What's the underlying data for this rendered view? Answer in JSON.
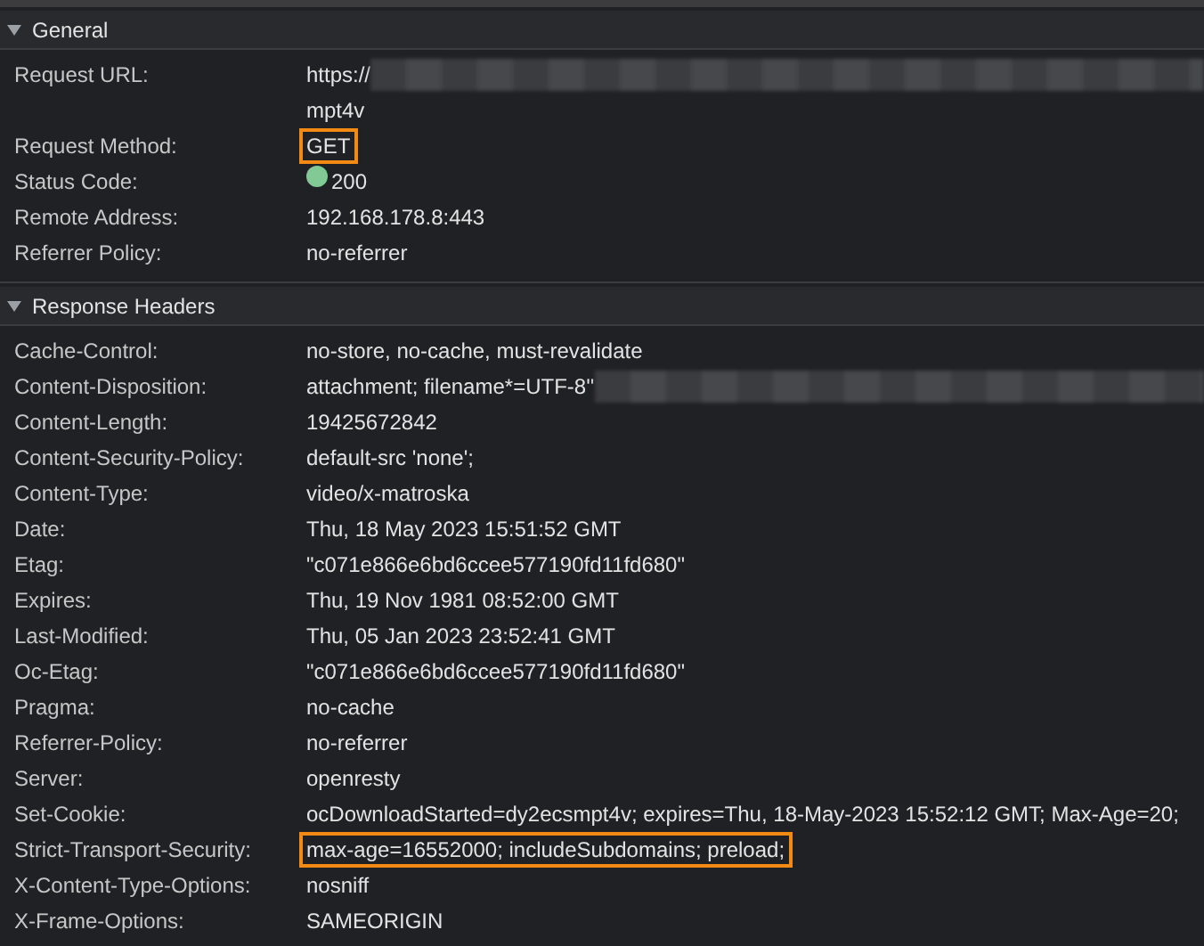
{
  "sections": [
    {
      "title": "General",
      "expanded": true,
      "rows": [
        {
          "name": "Request URL:",
          "value": "https://",
          "redacted": true,
          "continuation": "mpt4v",
          "highlighted": false
        },
        {
          "name": "Request Method:",
          "value": "GET",
          "redacted": false,
          "highlighted": true
        },
        {
          "name": "Status Code:",
          "value": "200",
          "redacted": false,
          "highlighted": false,
          "color": "#81c995"
        },
        {
          "name": "Remote Address:",
          "value": "192.168.178.8:443",
          "redacted": false,
          "highlighted": false
        },
        {
          "name": "Referrer Policy:",
          "value": "no-referrer",
          "redacted": false,
          "highlighted": false
        }
      ]
    },
    {
      "title": "Response Headers",
      "expanded": true,
      "rows": [
        {
          "name": "Cache-Control:",
          "value": "no-store, no-cache, must-revalidate",
          "redacted": false,
          "highlighted": false
        },
        {
          "name": "Content-Disposition:",
          "value": "attachment; filename*=UTF-8''",
          "redacted": true,
          "highlighted": false
        },
        {
          "name": "Content-Length:",
          "value": "19425672842",
          "redacted": false,
          "highlighted": false
        },
        {
          "name": "Content-Security-Policy:",
          "value": "default-src 'none';",
          "redacted": false,
          "highlighted": false
        },
        {
          "name": "Content-Type:",
          "value": "video/x-matroska",
          "redacted": false,
          "highlighted": false
        },
        {
          "name": "Date:",
          "value": "Thu, 18 May 2023 15:51:52 GMT",
          "redacted": false,
          "highlighted": false
        },
        {
          "name": "Etag:",
          "value": "\"c071e866e6bd6ccee577190fd11fd680\"",
          "redacted": false,
          "highlighted": false
        },
        {
          "name": "Expires:",
          "value": "Thu, 19 Nov 1981 08:52:00 GMT",
          "redacted": false,
          "highlighted": false
        },
        {
          "name": "Last-Modified:",
          "value": "Thu, 05 Jan 2023 23:52:41 GMT",
          "redacted": false,
          "highlighted": false
        },
        {
          "name": "Oc-Etag:",
          "value": "\"c071e866e6bd6ccee577190fd11fd680\"",
          "redacted": false,
          "highlighted": false
        },
        {
          "name": "Pragma:",
          "value": "no-cache",
          "redacted": false,
          "highlighted": false
        },
        {
          "name": "Referrer-Policy:",
          "value": "no-referrer",
          "redacted": false,
          "highlighted": false
        },
        {
          "name": "Server:",
          "value": "openresty",
          "redacted": false,
          "highlighted": false
        },
        {
          "name": "Set-Cookie:",
          "value": "ocDownloadStarted=dy2ecsmpt4v; expires=Thu, 18-May-2023 15:52:12 GMT; Max-Age=20;",
          "redacted": false,
          "highlighted": false
        },
        {
          "name": "Strict-Transport-Security:",
          "value": "max-age=16552000; includeSubdomains; preload;",
          "redacted": false,
          "highlighted": true
        },
        {
          "name": "X-Content-Type-Options:",
          "value": "nosniff",
          "redacted": false,
          "highlighted": false
        },
        {
          "name": "X-Frame-Options:",
          "value": "SAMEORIGIN",
          "redacted": false,
          "highlighted": false
        }
      ]
    }
  ]
}
